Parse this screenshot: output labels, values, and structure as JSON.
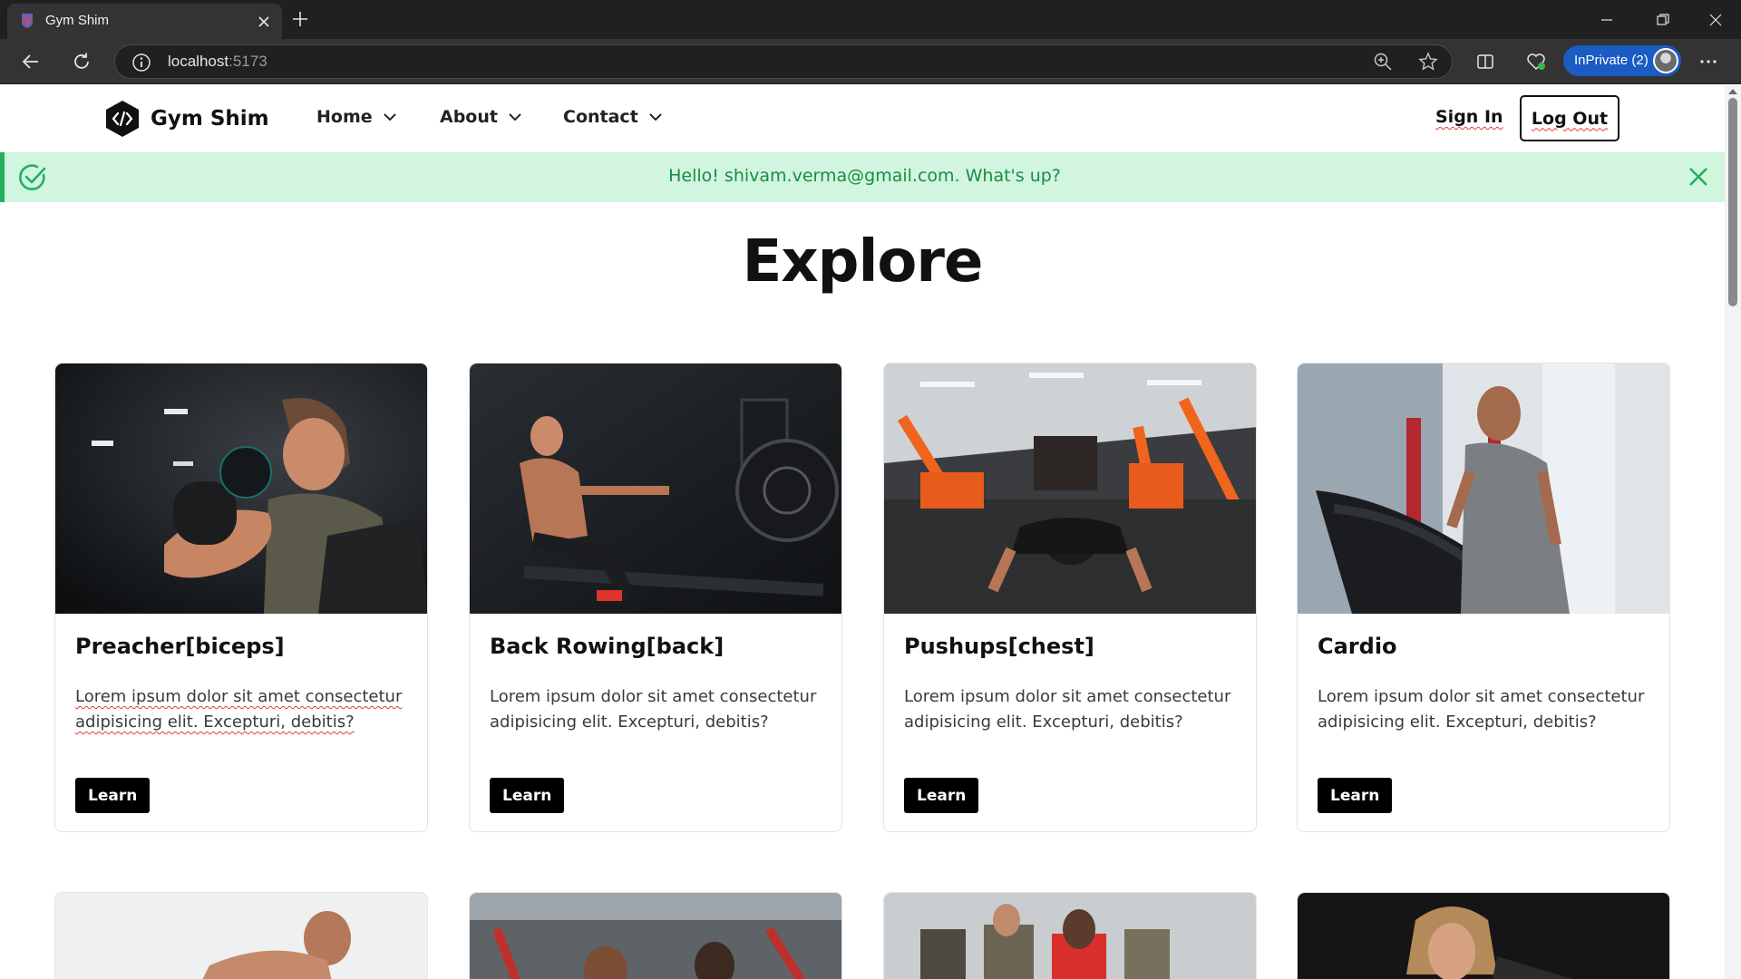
{
  "browser": {
    "tab_title": "Gym Shim",
    "url_host": "localhost",
    "url_port": ":5173",
    "inprivate_label": "InPrivate (2)",
    "accent_color": "#1a5bc4"
  },
  "navbar": {
    "brand": "Gym Shim",
    "items": [
      {
        "label": "Home"
      },
      {
        "label": "About"
      },
      {
        "label": "Contact"
      }
    ],
    "sign_in": "Sign In",
    "log_out": "Log Out"
  },
  "alert": {
    "message": "Hello! shivam.verma@gmail.com. What's up?",
    "color": "#1b8b46",
    "background": "#d1f5df"
  },
  "page": {
    "title": "Explore"
  },
  "cards": [
    {
      "title": "Preacher[biceps]",
      "description": "Lorem ipsum dolor sit amet consectetur adipisicing elit. Excepturi, debitis?",
      "button": "Learn"
    },
    {
      "title": "Back Rowing[back]",
      "description": "Lorem ipsum dolor sit amet consectetur adipisicing elit. Excepturi, debitis?",
      "button": "Learn"
    },
    {
      "title": "Pushups[chest]",
      "description": "Lorem ipsum dolor sit amet consectetur adipisicing elit. Excepturi, debitis?",
      "button": "Learn"
    },
    {
      "title": "Cardio",
      "description": "Lorem ipsum dolor sit amet consectetur adipisicing elit. Excepturi, debitis?",
      "button": "Learn"
    }
  ]
}
